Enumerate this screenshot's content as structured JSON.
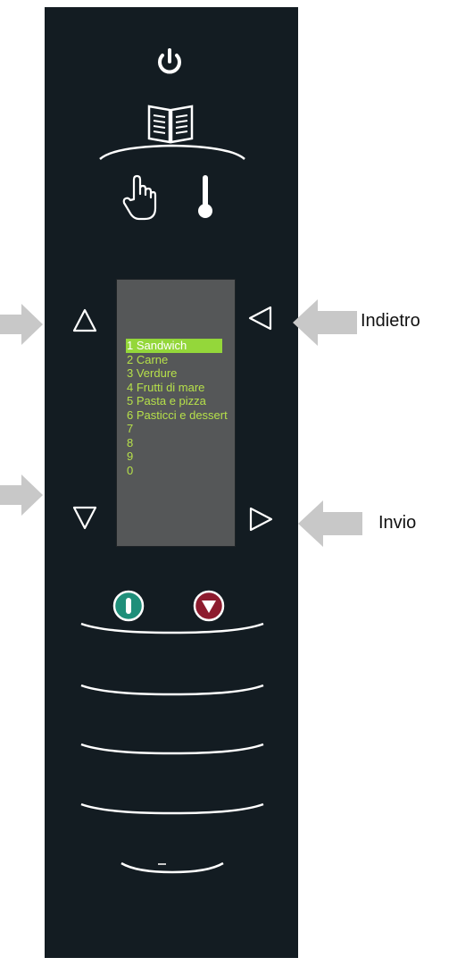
{
  "screen": {
    "items": [
      {
        "label": "1 Sandwich",
        "selected": true
      },
      {
        "label": "2 Carne"
      },
      {
        "label": "3 Verdure"
      },
      {
        "label": "4 Frutti di mare"
      },
      {
        "label": "5 Pasta e pizza"
      },
      {
        "label": "6 Pasticci e dessert"
      },
      {
        "label": "7"
      },
      {
        "label": "8"
      },
      {
        "label": "9"
      },
      {
        "label": "0"
      }
    ]
  },
  "annotations": {
    "back_label": "Indietro",
    "send_label": "Invio"
  },
  "colors": {
    "panel": "#131c22",
    "screen_bg": "#555758",
    "menu_text": "#b6e04a",
    "menu_selected_bg": "#94d73a",
    "start_button": "#1f8f7a",
    "stop_button": "#8d1b2e",
    "pointer_arrow": "#c8c8c8"
  },
  "icons": [
    "power-icon",
    "book-icon",
    "hand-icon",
    "thermometer-icon",
    "up-arrow-icon",
    "down-arrow-icon",
    "left-arrow-icon",
    "right-arrow-icon",
    "start-icon",
    "stop-icon"
  ]
}
